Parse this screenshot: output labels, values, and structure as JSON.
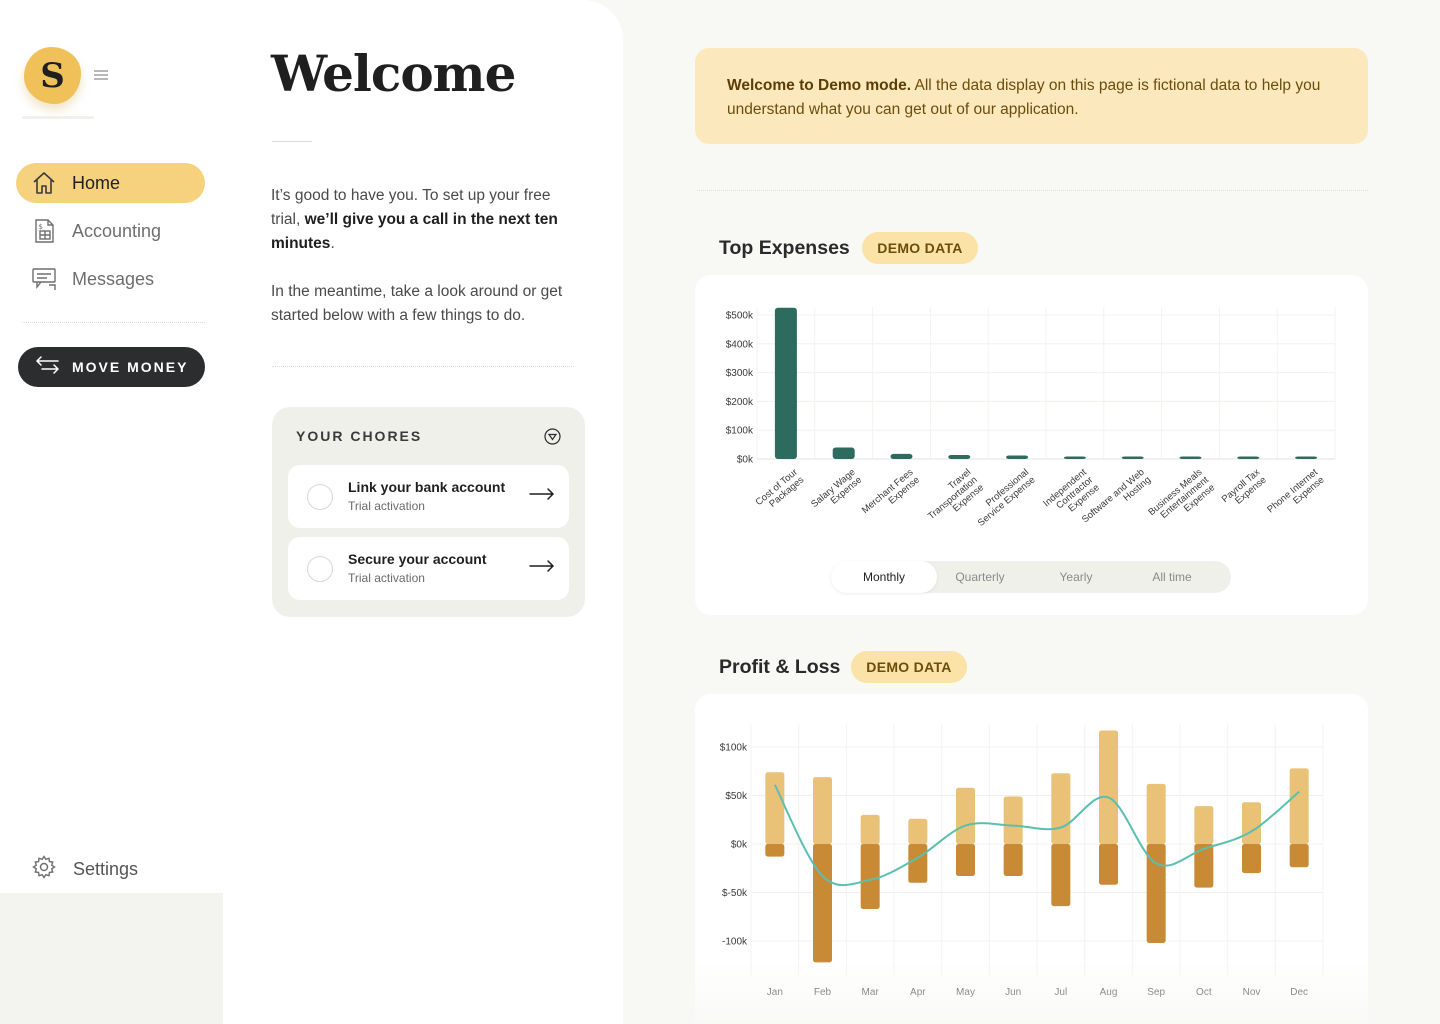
{
  "app": {
    "logo_letter": "S"
  },
  "sidebar": {
    "items": [
      {
        "label": "Home",
        "icon": "home-icon",
        "active": true
      },
      {
        "label": "Accounting",
        "icon": "ledger-icon",
        "active": false
      },
      {
        "label": "Messages",
        "icon": "chat-icon",
        "active": false
      }
    ],
    "move_money_label": "MOVE MONEY",
    "settings_label": "Settings"
  },
  "welcome": {
    "title": "Welcome",
    "intro_lead": "It’s good to have you. To set up your free trial, ",
    "intro_bold": "we’ll give you a call in the next ten minutes",
    "intro_tail": ".",
    "intro2": "In the meantime, take a look around or get started below with a few things to do."
  },
  "chores": {
    "title": "YOUR CHORES",
    "items": [
      {
        "title": "Link your bank account",
        "subtitle": "Trial activation"
      },
      {
        "title": "Secure your account",
        "subtitle": "Trial activation"
      }
    ]
  },
  "banner": {
    "bold": "Welcome to Demo mode.",
    "text": " All the data display on this page is fictional data to help you understand what you can get out of our application."
  },
  "top_expenses": {
    "title": "Top Expenses",
    "badge": "DEMO DATA",
    "ranges": [
      "Monthly",
      "Quarterly",
      "Yearly",
      "All time"
    ],
    "active_range": "Monthly"
  },
  "profit_loss": {
    "title": "Profit & Loss",
    "badge": "DEMO DATA"
  },
  "colors": {
    "accent": "#f6d27f",
    "expense_bar": "#2d6b5e",
    "income_bar": "#e9c177",
    "expense_neg_bar": "#c98a35",
    "net_line": "#5bbfb0",
    "banner_bg": "#fbe8bd"
  },
  "chart_data": [
    {
      "type": "bar",
      "title": "Top Expenses",
      "categories": [
        [
          "Cost of Tour",
          "Packages"
        ],
        [
          "Salary Wage",
          "Expense"
        ],
        [
          "Merchant Fees",
          "Expense"
        ],
        [
          "Travel",
          "Transportation",
          "Expense"
        ],
        [
          "Professional",
          "Service Expense"
        ],
        [
          "Independent",
          "Contractor",
          "Expense"
        ],
        [
          "Software and Web",
          "Hosting"
        ],
        [
          "Business Meals",
          "Entertainment",
          "Expense"
        ],
        [
          "Payroll Tax",
          "Expense"
        ],
        [
          "Phone Internet",
          "Expense"
        ]
      ],
      "values": [
        525000,
        40000,
        18000,
        14000,
        12000,
        7000,
        6000,
        4000,
        3000,
        2500
      ],
      "yticks": [
        "$0k",
        "$100k",
        "$200k",
        "$300k",
        "$400k",
        "$500k"
      ],
      "ylim": [
        0,
        500000
      ],
      "grid": true
    },
    {
      "type": "bar",
      "title": "Profit & Loss",
      "categories": [
        "Jan",
        "Feb",
        "Mar",
        "Apr",
        "May",
        "Jun",
        "Jul",
        "Aug",
        "Sep",
        "Oct",
        "Nov",
        "Dec"
      ],
      "series": [
        {
          "values": [
            74000,
            69000,
            30000,
            26000,
            58000,
            49000,
            73000,
            117000,
            62000,
            39000,
            43000,
            78000
          ]
        },
        {
          "values": [
            -13000,
            -122000,
            -67000,
            -40000,
            -33000,
            -33000,
            -64000,
            -42000,
            -102000,
            -45000,
            -30000,
            -24000
          ]
        }
      ],
      "line": [
        61000,
        -33000,
        -37000,
        -14000,
        19000,
        19000,
        17000,
        48000,
        -20000,
        -5000,
        13000,
        54000
      ],
      "yticks": [
        "$100k",
        "$50k",
        "$0k",
        "$-50k",
        "-100k"
      ],
      "ylim": [
        -100000,
        100000
      ],
      "grid": true
    }
  ]
}
